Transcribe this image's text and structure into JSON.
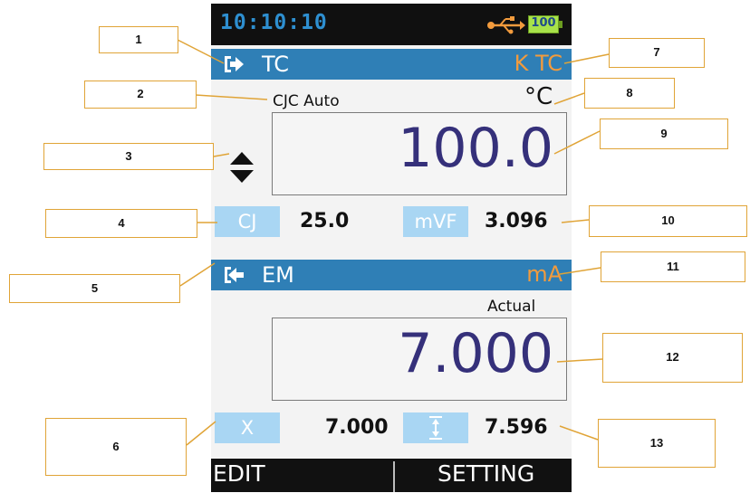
{
  "status": {
    "time": "10:10:10",
    "battery_level": "100"
  },
  "channel1": {
    "mode_label": "TC",
    "type_label": "K TC",
    "cjc_text": "CJC Auto",
    "unit": "°C",
    "value": "100.0",
    "cj_chip": "CJ",
    "cj_value": "25.0",
    "mvf_chip": "mVF",
    "mvf_value": "3.096"
  },
  "channel2": {
    "mode_label": "EM",
    "unit": "mA",
    "actual_label": "Actual",
    "value": "7.000",
    "x_chip": "X",
    "x_value": "7.000",
    "span_value": "7.596"
  },
  "softkeys": {
    "left": "EDIT",
    "right": "SETTING"
  },
  "callouts": [
    "1",
    "2",
    "3",
    "4",
    "5",
    "6",
    "7",
    "8",
    "9",
    "10",
    "11",
    "12",
    "13"
  ],
  "colors": {
    "bar_blue": "#2f7fb6",
    "unit_orange": "#f29b3d",
    "value_navy": "#35307a",
    "chip_blue": "#a9d6f3",
    "time_blue": "#2e8fd0",
    "callout_border": "#e0a437"
  },
  "icons": [
    "usb-icon",
    "battery-icon",
    "source-icon",
    "measure-icon",
    "up-down-arrows-icon",
    "vertical-span-icon"
  ]
}
